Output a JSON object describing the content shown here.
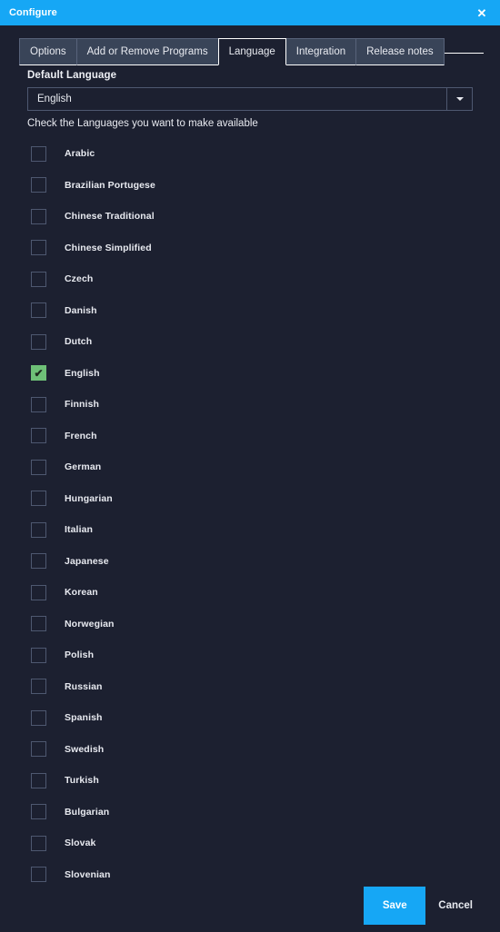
{
  "window": {
    "title": "Configure",
    "close_icon": "close-icon",
    "accent_color": "#16a7f5",
    "background_color": "#1c2030"
  },
  "tabs": [
    {
      "label": "Options",
      "active": false
    },
    {
      "label": "Add or Remove Programs",
      "active": false
    },
    {
      "label": "Language",
      "active": true
    },
    {
      "label": "Integration",
      "active": false
    },
    {
      "label": "Release notes",
      "active": false
    }
  ],
  "form": {
    "default_language_label": "Default Language",
    "default_language_value": "English",
    "dropdown_icon": "chevron-down-icon",
    "hint": "Check the Languages you want to make available"
  },
  "languages": [
    {
      "label": "Arabic",
      "checked": false
    },
    {
      "label": "Brazilian Portugese",
      "checked": false
    },
    {
      "label": "Chinese Traditional",
      "checked": false
    },
    {
      "label": "Chinese Simplified",
      "checked": false
    },
    {
      "label": "Czech",
      "checked": false
    },
    {
      "label": "Danish",
      "checked": false
    },
    {
      "label": "Dutch",
      "checked": false
    },
    {
      "label": "English",
      "checked": true
    },
    {
      "label": "Finnish",
      "checked": false
    },
    {
      "label": "French",
      "checked": false
    },
    {
      "label": "German",
      "checked": false
    },
    {
      "label": "Hungarian",
      "checked": false
    },
    {
      "label": "Italian",
      "checked": false
    },
    {
      "label": "Japanese",
      "checked": false
    },
    {
      "label": "Korean",
      "checked": false
    },
    {
      "label": "Norwegian",
      "checked": false
    },
    {
      "label": "Polish",
      "checked": false
    },
    {
      "label": "Russian",
      "checked": false
    },
    {
      "label": "Spanish",
      "checked": false
    },
    {
      "label": "Swedish",
      "checked": false
    },
    {
      "label": "Turkish",
      "checked": false
    },
    {
      "label": "Bulgarian",
      "checked": false
    },
    {
      "label": "Slovak",
      "checked": false
    },
    {
      "label": "Slovenian",
      "checked": false
    }
  ],
  "checkbox": {
    "checked_color": "#6ec077",
    "tick_glyph": "✔"
  },
  "footer": {
    "save_label": "Save",
    "cancel_label": "Cancel"
  }
}
